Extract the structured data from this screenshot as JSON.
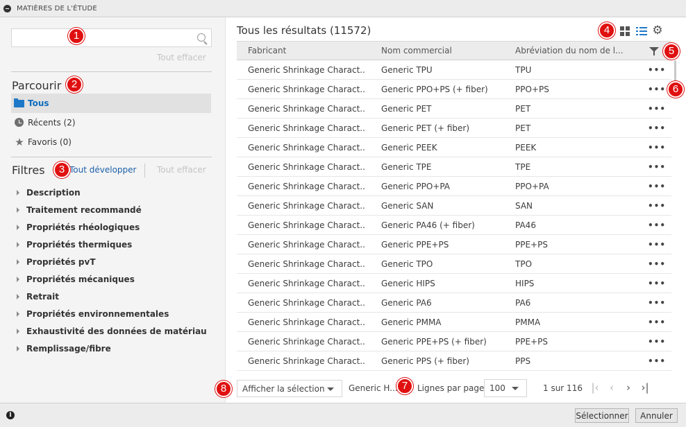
{
  "window": {
    "title": "MATIÈRES DE L'ÉTUDE"
  },
  "sidebar": {
    "search": {
      "value": "",
      "placeholder": ""
    },
    "clear_all_top": "Tout effacer",
    "browse_title": "Parcourir",
    "browse_items": [
      {
        "label": "Tous",
        "icon": "folder-icon",
        "active": true
      },
      {
        "label": "Récents (2)",
        "icon": "clock-icon",
        "active": false
      },
      {
        "label": "Favoris (0)",
        "icon": "star-icon",
        "active": false
      }
    ],
    "filters_title": "Filtres",
    "expand_all": "Tout développer",
    "clear_all_filters": "Tout effacer",
    "filters": [
      "Description",
      "Traitement recommandé",
      "Propriétés rhéologiques",
      "Propriétés thermiques",
      "Propriétés pvT",
      "Propriétés mécaniques",
      "Retrait",
      "Propriétés environnementales",
      "Exhaustivité des données de matériau",
      "Remplissage/fibre"
    ]
  },
  "main": {
    "results_title": "Tous les résultats (11572)",
    "columns": [
      "Fabricant",
      "Nom commercial",
      "Abréviation du nom de l..."
    ],
    "rows": [
      [
        "Generic Shrinkage Charact...",
        "Generic TPU",
        "TPU"
      ],
      [
        "Generic Shrinkage Charact...",
        "Generic PPO+PS (+ fiber)",
        "PPO+PS"
      ],
      [
        "Generic Shrinkage Charact...",
        "Generic PET",
        "PET"
      ],
      [
        "Generic Shrinkage Charact...",
        "Generic PET (+ fiber)",
        "PET"
      ],
      [
        "Generic Shrinkage Charact...",
        "Generic PEEK",
        "PEEK"
      ],
      [
        "Generic Shrinkage Charact...",
        "Generic TPE",
        "TPE"
      ],
      [
        "Generic Shrinkage Charact...",
        "Generic PPO+PA",
        "PPO+PA"
      ],
      [
        "Generic Shrinkage Charact...",
        "Generic SAN",
        "SAN"
      ],
      [
        "Generic Shrinkage Charact...",
        "Generic PA46 (+ fiber)",
        "PA46"
      ],
      [
        "Generic Shrinkage Charact...",
        "Generic PPE+PS",
        "PPE+PS"
      ],
      [
        "Generic Shrinkage Charact...",
        "Generic TPO",
        "TPO"
      ],
      [
        "Generic Shrinkage Charact...",
        "Generic HIPS",
        "HIPS"
      ],
      [
        "Generic Shrinkage Charact...",
        "Generic PA6",
        "PA6"
      ],
      [
        "Generic Shrinkage Charact...",
        "Generic PMMA",
        "PMMA"
      ],
      [
        "Generic Shrinkage Charact...",
        "Generic PPE+PS (+ fiber)",
        "PPE+PS"
      ],
      [
        "Generic Shrinkage Charact...",
        "Generic PPS (+ fiber)",
        "PPS"
      ]
    ],
    "row_menu_glyph": "•••",
    "show_selection": "Afficher la sélection",
    "selected_name": "Generic H...",
    "rows_per_page_label": "Lignes par page:",
    "rows_per_page_value": "100",
    "page_info": "1 sur 116",
    "pager": {
      "first": "|‹",
      "prev": "‹",
      "next": "›",
      "last": "›|"
    }
  },
  "footer": {
    "info_glyph": "i",
    "select_button": "Sélectionner",
    "cancel_button": "Annuler"
  },
  "markers": [
    "1",
    "2",
    "3",
    "4",
    "5",
    "6",
    "7",
    "8"
  ],
  "colors": {
    "accent": "#1e78c8",
    "marker": "#e01010",
    "link": "#1a5fa8"
  }
}
